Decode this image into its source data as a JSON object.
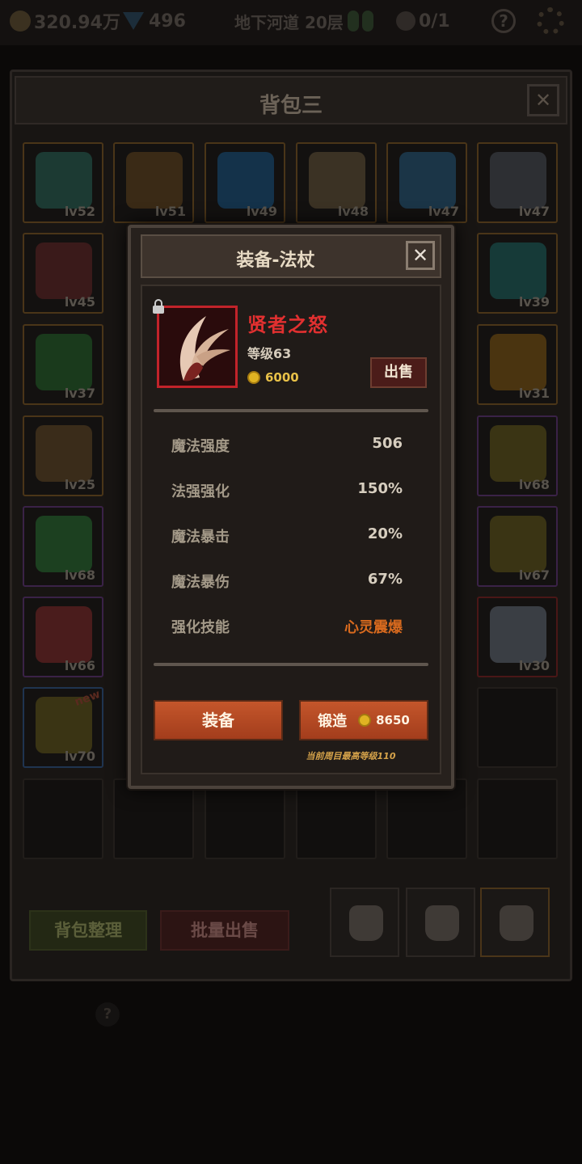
{
  "topbar": {
    "gold": "320.94万",
    "gems": "496",
    "location": "地下河道 20层",
    "kills": "0/1",
    "help": "?"
  },
  "backpack": {
    "title": "背包三",
    "close": "✕",
    "slots": [
      {
        "lv": "lv52",
        "quality": "orange",
        "color": "#1c3a33"
      },
      {
        "lv": "lv51",
        "quality": "orange",
        "color": "#3a2a16"
      },
      {
        "lv": "lv49",
        "quality": "orange",
        "color": "#14324a"
      },
      {
        "lv": "lv48",
        "quality": "orange",
        "color": "#3b3224"
      },
      {
        "lv": "lv47",
        "quality": "orange",
        "color": "#1b3547"
      },
      {
        "lv": "lv47",
        "quality": "orange",
        "color": "#2d2f33"
      },
      {
        "lv": "lv45",
        "quality": "orange",
        "color": "#3a1a1a"
      },
      {
        "lv": "lv39",
        "quality": "orange",
        "color": "#163a38"
      },
      {
        "lv": "lv37",
        "quality": "orange",
        "color": "#1a3a1c"
      },
      {
        "lv": "lv31",
        "quality": "orange",
        "color": "#4a3410"
      },
      {
        "lv": "lv25",
        "quality": "orange",
        "color": "#3a2c1a"
      },
      {
        "lv": "lv68",
        "quality": "purple",
        "color": "#3a3414"
      },
      {
        "lv": "lv68",
        "quality": "purple",
        "color": "#1c4020"
      },
      {
        "lv": "lv67",
        "quality": "purple",
        "color": "#3a3414"
      },
      {
        "lv": "lv66",
        "quality": "purple",
        "color": "#4a1c1c"
      },
      {
        "lv": "lv30",
        "quality": "red",
        "color": "#3a3e44"
      },
      {
        "lv": "lv70",
        "quality": "blue",
        "color": "#3a3414",
        "tag": "new"
      }
    ],
    "sort_label": "背包整理",
    "bulk_sell_label": "批量出售",
    "help": "?"
  },
  "modal": {
    "title": "装备-法杖",
    "close": "✕",
    "item": {
      "name": "贤者之怒",
      "level": "等级63",
      "price": "6000",
      "sell_label": "出售"
    },
    "stats": [
      {
        "label": "魔法强度",
        "value": "506"
      },
      {
        "label": "法强强化",
        "value": "150%"
      },
      {
        "label": "魔法暴击",
        "value": "20%"
      },
      {
        "label": "魔法暴伤",
        "value": "67%"
      },
      {
        "label": "强化技能",
        "value": "心灵震爆"
      }
    ],
    "equip_label": "装备",
    "forge_label": "锻造",
    "forge_cost": "8650",
    "forge_note": "当前周目最高等级110"
  },
  "colors": {
    "item_name": "#e23030",
    "skill": "#d86a1e",
    "gold": "#e8c148",
    "button": "#b84a24"
  }
}
